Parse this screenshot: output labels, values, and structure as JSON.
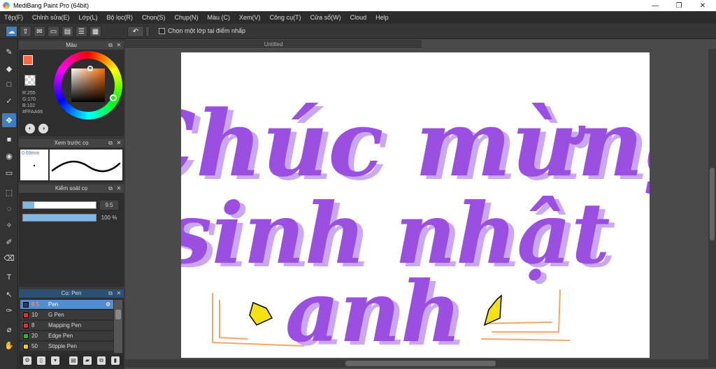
{
  "window": {
    "title": "MediBang Paint Pro (64bit)",
    "minimize": "—",
    "maximize": "❐",
    "close": "✕"
  },
  "menu": [
    "Tệp(F)",
    "Chỉnh sửa(E)",
    "Lớp(L)",
    "Bộ lọc(R)",
    "Chọn(S)",
    "Chụp(N)",
    "Màu (C)",
    "Xem(V)",
    "Công cụ(T)",
    "Cửa sổ(W)",
    "Cloud",
    "Help"
  ],
  "toolbar": {
    "checkbox_label": "Chọn một lớp tại điểm nhấp",
    "checkbox_checked": false
  },
  "color_panel": {
    "title": "Màu",
    "foreground": "#FF6A42",
    "r": "R:255",
    "g": "G:170",
    "b": "B:102",
    "hex": "#FFAA66"
  },
  "brush_preview": {
    "title": "Xem trước cọ",
    "size": "0.69mm"
  },
  "brush_control": {
    "title": "Kiểm soát cọ",
    "size_value": "9.5",
    "size_fraction": 0.15,
    "opacity_value": "100 %",
    "opacity_fraction": 1.0
  },
  "brush_list": {
    "title": "Cọ: Pen",
    "items": [
      {
        "size": "9.5",
        "name": "Pen",
        "color": "#2a3a66",
        "selected": true
      },
      {
        "size": "10",
        "name": "G Pen",
        "color": "#e03030",
        "selected": false
      },
      {
        "size": "8",
        "name": "Mapping Pen",
        "color": "#e03030",
        "selected": false
      },
      {
        "size": "20",
        "name": "Edge Pen",
        "color": "#30b030",
        "selected": false
      },
      {
        "size": "50",
        "name": "Stipple Pen",
        "color": "#e8d020",
        "selected": false
      }
    ]
  },
  "document": {
    "tab": "Untitled"
  },
  "artwork": {
    "line1": "Chúc mừng",
    "line2": "sinh nhật",
    "line3": "anh",
    "text_color": "#9B4FE0",
    "shadow_color": "#C9A8F0",
    "accent_color": "#F2A86A",
    "diamond_color": "#F5E014"
  }
}
